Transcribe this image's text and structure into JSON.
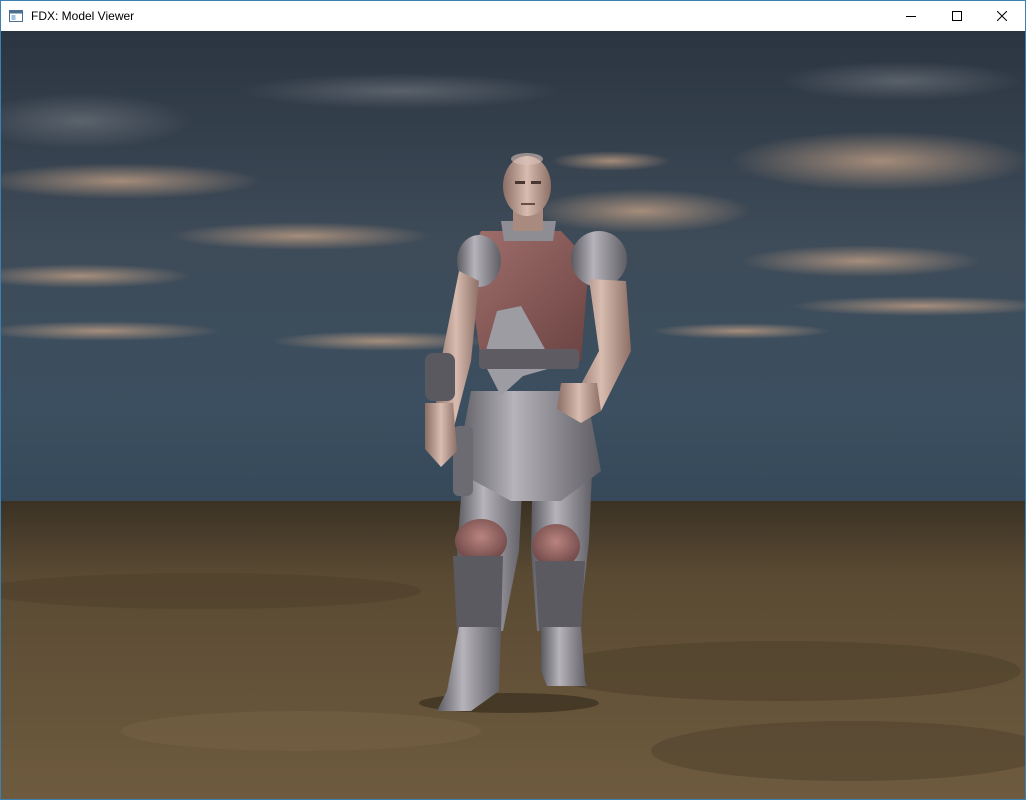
{
  "window": {
    "title": "FDX: Model Viewer",
    "icon": "app-window-icon",
    "controls": {
      "minimize_icon": "minimize-icon",
      "maximize_icon": "maximize-icon",
      "close_icon": "close-icon"
    }
  },
  "viewport": {
    "scene": "3d-model-render",
    "colors": {
      "sky_top": "#2f3a47",
      "sky_mid": "#4a5866",
      "horizon": "#3f5465",
      "cloud": "#c9a487",
      "ground_far": "#4a3d2a",
      "ground_near": "#6d5a3e",
      "armor": "#9c9aa0",
      "vest": "#8a5a58",
      "skin": "#c8a89a"
    }
  }
}
